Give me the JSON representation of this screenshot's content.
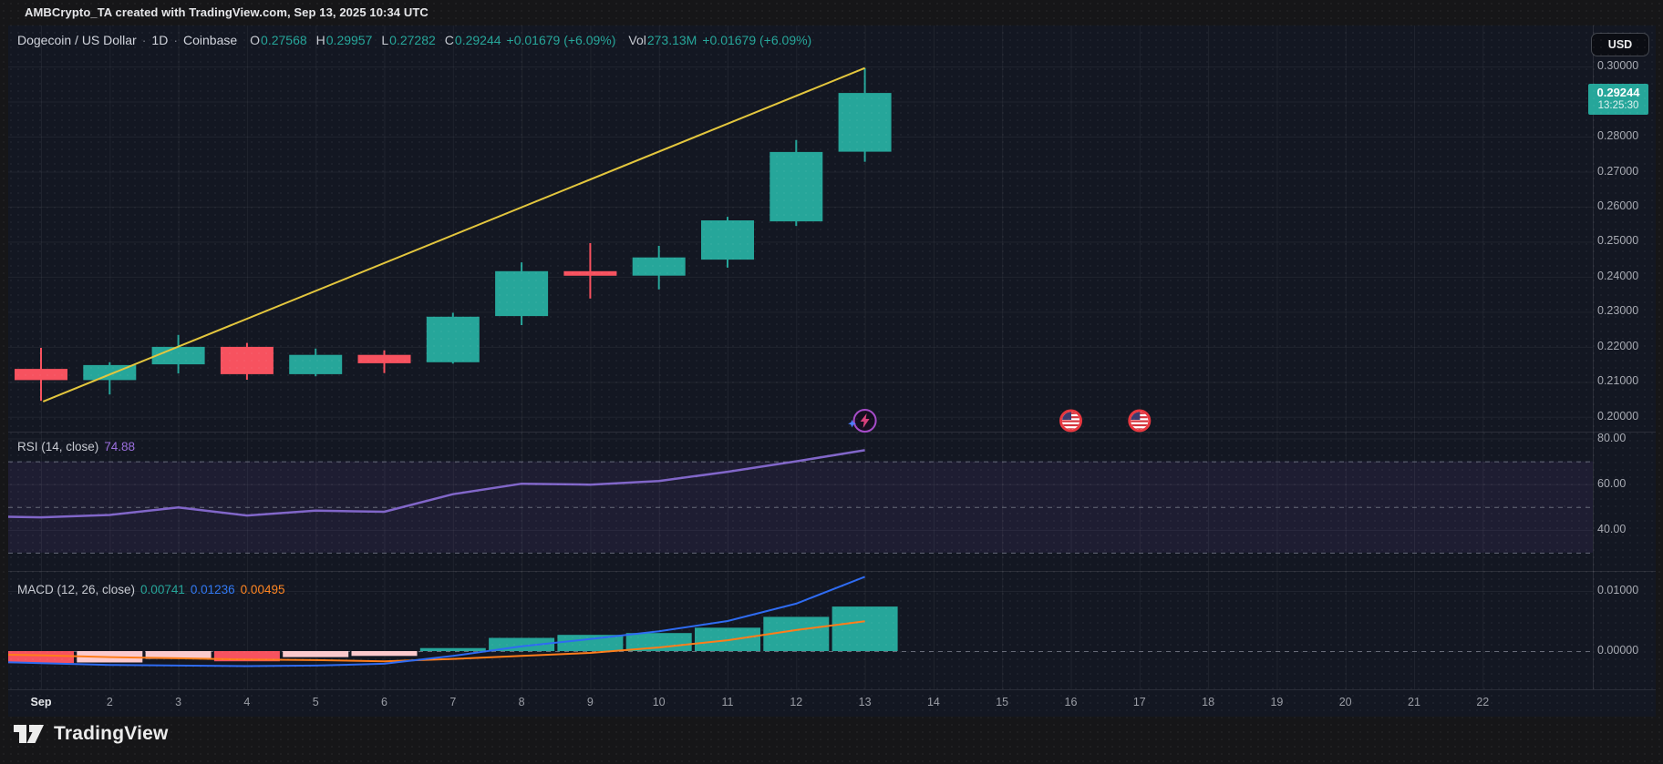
{
  "title_bar": {
    "title": "AMBCrypto_TA created with TradingView.com, Sep 13, 2025 10:34 UTC"
  },
  "header_legend": {
    "symbol": "Dogecoin / US Dollar",
    "separator": "·",
    "interval": "1D",
    "exchange": "Coinbase",
    "ohlc": [
      {
        "label": "O",
        "value": "0.27568"
      },
      {
        "label": "H",
        "value": "0.29957"
      },
      {
        "label": "L",
        "value": "0.27282"
      },
      {
        "label": "C",
        "value": "0.29244"
      }
    ],
    "change": "+0.01679 (+6.09%)",
    "volume_label": "Vol",
    "volume_value": "273.13M",
    "volume_change": "+0.01679 (+6.09%)"
  },
  "price_scale": {
    "currency_button": "USD",
    "last_price": "0.29244",
    "countdown": "13:25:30",
    "ticks": [
      "0.30000",
      "0.28000",
      "0.27000",
      "0.26000",
      "0.25000",
      "0.24000",
      "0.23000",
      "0.22000",
      "0.21000",
      "0.20000"
    ]
  },
  "rsi_panel": {
    "title": "RSI (14, close)",
    "value": "74.88",
    "ticks": [
      "80.00",
      "60.00",
      "40.00"
    ]
  },
  "macd_panel": {
    "title": "MACD (12, 26, close)",
    "histogram_value": "0.00741",
    "macd_value": "0.01236",
    "signal_value": "0.00495",
    "ticks": [
      "0.01000",
      "0.00000"
    ]
  },
  "time_axis": {
    "ticks": [
      {
        "day": 1,
        "label": "Sep",
        "major": true
      },
      {
        "day": 2,
        "label": "2"
      },
      {
        "day": 3,
        "label": "3"
      },
      {
        "day": 4,
        "label": "4"
      },
      {
        "day": 5,
        "label": "5"
      },
      {
        "day": 6,
        "label": "6"
      },
      {
        "day": 7,
        "label": "7"
      },
      {
        "day": 8,
        "label": "8"
      },
      {
        "day": 9,
        "label": "9"
      },
      {
        "day": 10,
        "label": "10"
      },
      {
        "day": 11,
        "label": "11"
      },
      {
        "day": 12,
        "label": "12"
      },
      {
        "day": 13,
        "label": "13"
      },
      {
        "day": 14,
        "label": "14"
      },
      {
        "day": 15,
        "label": "15"
      },
      {
        "day": 16,
        "label": "16"
      },
      {
        "day": 17,
        "label": "17"
      },
      {
        "day": 18,
        "label": "18"
      },
      {
        "day": 19,
        "label": "19"
      },
      {
        "day": 20,
        "label": "20"
      },
      {
        "day": 21,
        "label": "21"
      },
      {
        "day": 22,
        "label": "22"
      }
    ]
  },
  "footer": {
    "logo_text": "TradingView"
  },
  "colors": {
    "chart_bg": "#131722",
    "outer_bg": "#161618",
    "candle_up": "#26a69a",
    "candle_down": "#f7525f",
    "hist_below_falling": "#f7525f",
    "hist_below_rising": "#fbc9cc",
    "hist_above": "#26a69a",
    "macd_line": "#2e6bf2",
    "signal_line": "#ff7d1a",
    "rsi_line": "#8166c9",
    "rsi_band_fill": "rgba(126,87,194,0.10)",
    "trendline": "#e3c63d",
    "badge_bg": "#26a69a",
    "grid": "rgba(255,255,255,0.055)",
    "separator": "rgba(255,255,255,0.10)",
    "dashed_level": "#6e7280"
  },
  "chart_data": [
    {
      "type": "candlestick",
      "title": "Dogecoin / US Dollar, 1D, Coinbase",
      "categories": [
        "Sep 1",
        "Sep 2",
        "Sep 3",
        "Sep 4",
        "Sep 5",
        "Sep 6",
        "Sep 7",
        "Sep 8",
        "Sep 9",
        "Sep 10",
        "Sep 11",
        "Sep 12",
        "Sep 13"
      ],
      "ohlc": [
        [
          0.2137,
          0.2197,
          0.2046,
          0.2105
        ],
        [
          0.2105,
          0.2156,
          0.2064,
          0.2148
        ],
        [
          0.215,
          0.2234,
          0.2124,
          0.22
        ],
        [
          0.22,
          0.2211,
          0.2106,
          0.2122
        ],
        [
          0.2122,
          0.2195,
          0.2116,
          0.2177
        ],
        [
          0.2177,
          0.219,
          0.2125,
          0.2153
        ],
        [
          0.2156,
          0.2297,
          0.2152,
          0.2286
        ],
        [
          0.2288,
          0.2441,
          0.2262,
          0.2416
        ],
        [
          0.2416,
          0.2496,
          0.2338,
          0.2403
        ],
        [
          0.2403,
          0.2488,
          0.2364,
          0.2455
        ],
        [
          0.2449,
          0.2571,
          0.2426,
          0.2561
        ],
        [
          0.2558,
          0.279,
          0.2545,
          0.2756
        ],
        [
          0.27568,
          0.29957,
          0.27282,
          0.29244
        ]
      ],
      "ylim": [
        0.1958,
        0.3117
      ],
      "xlim_days": [
        0.5,
        23.6
      ],
      "grid": true,
      "trendline": {
        "from_day": 1.03,
        "from_price": 0.2044,
        "to_day": 13,
        "to_price": 0.29957
      },
      "markers": [
        {
          "day": 13,
          "type": "lightning-event"
        },
        {
          "day": 16,
          "type": "us-flag-event"
        },
        {
          "day": 17,
          "type": "us-flag-event"
        }
      ]
    },
    {
      "type": "line",
      "name": "RSI (14, close)",
      "x": [
        "Aug 31",
        "Sep 1",
        "Sep 2",
        "Sep 3",
        "Sep 4",
        "Sep 5",
        "Sep 6",
        "Sep 7",
        "Sep 8",
        "Sep 9",
        "Sep 10",
        "Sep 11",
        "Sep 12",
        "Sep 13"
      ],
      "start_day": 0,
      "values": [
        46.0,
        45.5,
        46.5,
        49.8,
        46.3,
        48.4,
        47.9,
        55.6,
        60.2,
        59.8,
        61.4,
        65.4,
        70.0,
        74.88
      ],
      "ylim": [
        22,
        83
      ],
      "levels": {
        "upper_band": 70,
        "middle": 50,
        "lower_band": 30
      }
    },
    {
      "type": "macd",
      "name": "MACD (12, 26, close)",
      "x": [
        "Aug 31",
        "Sep 1",
        "Sep 2",
        "Sep 3",
        "Sep 4",
        "Sep 5",
        "Sep 6",
        "Sep 7",
        "Sep 8",
        "Sep 9",
        "Sep 10",
        "Sep 11",
        "Sep 12",
        "Sep 13"
      ],
      "start_day": 0,
      "macd": [
        -0.0017,
        -0.002,
        -0.0023,
        -0.0024,
        -0.0025,
        -0.0024,
        -0.0021,
        -0.0008,
        0.0008,
        0.002,
        0.0033,
        0.005,
        0.0079,
        0.01236
      ],
      "signal": [
        -0.0005,
        -0.0007,
        -0.001,
        -0.0012,
        -0.0014,
        -0.0015,
        -0.0017,
        -0.0013,
        -0.0008,
        -0.0003,
        0.0006,
        0.0018,
        0.0035,
        0.00495
      ],
      "histogram_x": [
        "Sep 1",
        "Sep 2",
        "Sep 3",
        "Sep 4",
        "Sep 5",
        "Sep 6",
        "Sep 7",
        "Sep 8",
        "Sep 9",
        "Sep 10",
        "Sep 11",
        "Sep 12",
        "Sep 13"
      ],
      "histogram": [
        -0.002,
        -0.0019,
        -0.0013,
        -0.0017,
        -0.001,
        -0.0008,
        0.0005,
        0.0022,
        0.0027,
        0.003,
        0.0039,
        0.0057,
        0.00741
      ],
      "histogram_state": [
        "below-falling",
        "below-rising",
        "below-rising",
        "below-falling",
        "below-rising",
        "below-rising",
        "above-rising",
        "above-rising",
        "above-rising",
        "above-rising",
        "above-rising",
        "above-rising",
        "above-rising"
      ],
      "ylim": [
        -0.00636,
        0.01333
      ],
      "zero_line": 0.0
    }
  ]
}
